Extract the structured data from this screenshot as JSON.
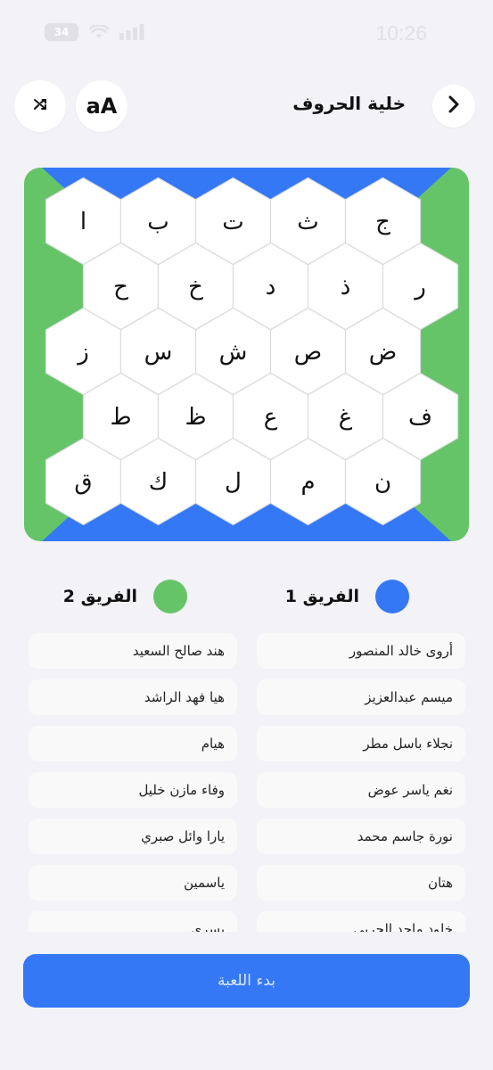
{
  "status_bar": {
    "time": "10:26",
    "battery": "34"
  },
  "header": {
    "title": "خلية الحروف",
    "font_button": "aA"
  },
  "icons": {
    "shuffle": "shuffle-icon",
    "font": "font-size-icon",
    "next": "chevron-right-icon"
  },
  "colors": {
    "team1": "#3478f6",
    "team2": "#66c468",
    "background": "#f2f2f7",
    "hex_fill": "#ffffff",
    "accent": "#3478f6"
  },
  "board": {
    "rows": [
      [
        "ا",
        "ب",
        "ت",
        "ث",
        "ج"
      ],
      [
        "ح",
        "خ",
        "د",
        "ذ",
        "ر"
      ],
      [
        "ز",
        "س",
        "ش",
        "ص",
        "ض"
      ],
      [
        "ط",
        "ظ",
        "ع",
        "غ",
        "ف"
      ],
      [
        "ق",
        "ك",
        "ل",
        "م",
        "ن"
      ]
    ]
  },
  "teams": [
    {
      "name": "الفريق 1",
      "members": [
        "أروى خالد المنصور",
        "ميسم عبدالعزيز",
        "نجلاء باسل مطر",
        "نغم ياسر عوض",
        "نورة جاسم محمد",
        "هتان",
        "خلود ماجد الحربي"
      ]
    },
    {
      "name": "الفريق 2",
      "members": [
        "هند صالح السعيد",
        "هيا فهد الراشد",
        "هيام",
        "وفاء مازن خليل",
        "يارا وائل صبري",
        "ياسمين",
        "يسرى"
      ]
    }
  ],
  "start_button": "بدء اللعبة"
}
